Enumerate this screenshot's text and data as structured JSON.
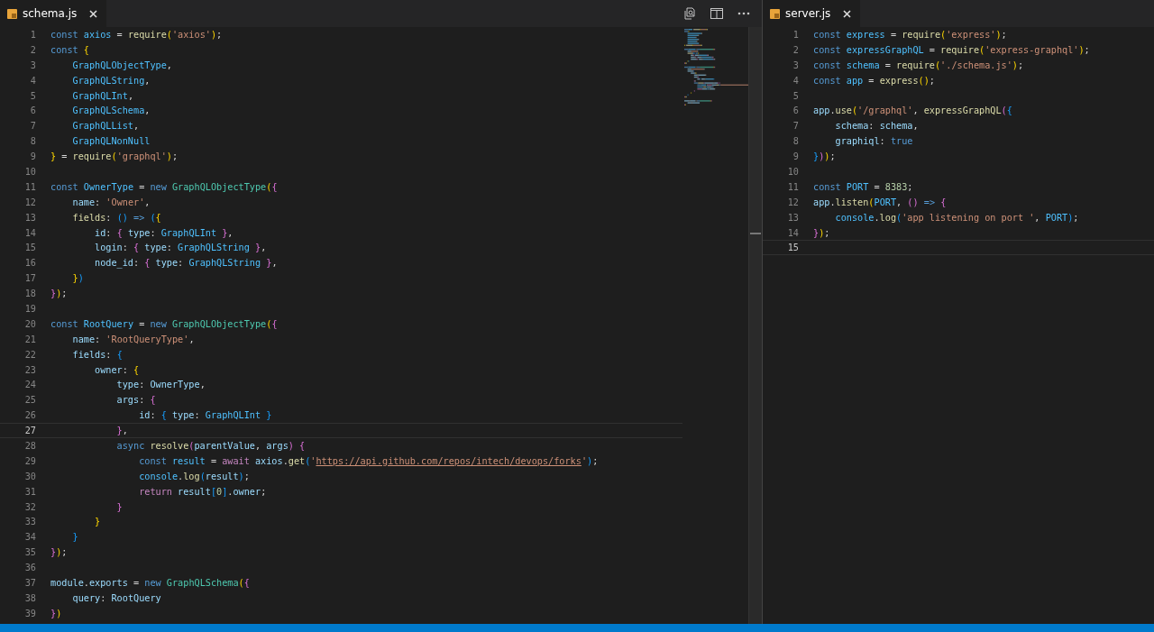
{
  "editor_groups": [
    {
      "tab": {
        "label": "schema.js",
        "selected": true
      },
      "actions": true,
      "minimap": true,
      "lines": [
        {
          "number": "1",
          "current": false,
          "tokens": [
            {
              "text": "const ",
              "kind": "keyword"
            },
            {
              "text": "axios",
              "kind": "constant"
            },
            {
              "text": " = ",
              "kind": "plain"
            },
            {
              "text": "require",
              "kind": "function"
            },
            {
              "text": "(",
              "kind": "bracket1"
            },
            {
              "text": "'axios'",
              "kind": "string"
            },
            {
              "text": ")",
              "kind": "bracket1"
            },
            {
              "text": ";",
              "kind": "plain"
            }
          ]
        },
        {
          "number": "2",
          "current": false,
          "tokens": [
            {
              "text": "const ",
              "kind": "keyword"
            },
            {
              "text": "{",
              "kind": "bracket1"
            }
          ]
        },
        {
          "number": "3",
          "current": false,
          "tokens": [
            {
              "text": "    GraphQLObjectType",
              "kind": "constant"
            },
            {
              "text": ",",
              "kind": "plain"
            }
          ]
        },
        {
          "number": "4",
          "current": false,
          "tokens": [
            {
              "text": "    GraphQLString",
              "kind": "constant"
            },
            {
              "text": ",",
              "kind": "plain"
            }
          ]
        },
        {
          "number": "5",
          "current": false,
          "tokens": [
            {
              "text": "    GraphQLInt",
              "kind": "constant"
            },
            {
              "text": ",",
              "kind": "plain"
            }
          ]
        },
        {
          "number": "6",
          "current": false,
          "tokens": [
            {
              "text": "    GraphQLSchema",
              "kind": "constant"
            },
            {
              "text": ",",
              "kind": "plain"
            }
          ]
        },
        {
          "number": "7",
          "current": false,
          "tokens": [
            {
              "text": "    GraphQLList",
              "kind": "constant"
            },
            {
              "text": ",",
              "kind": "plain"
            }
          ]
        },
        {
          "number": "8",
          "current": false,
          "tokens": [
            {
              "text": "    GraphQLNonNull",
              "kind": "constant"
            }
          ]
        },
        {
          "number": "9",
          "current": false,
          "tokens": [
            {
              "text": "}",
              "kind": "bracket1"
            },
            {
              "text": " = ",
              "kind": "plain"
            },
            {
              "text": "require",
              "kind": "function"
            },
            {
              "text": "(",
              "kind": "bracket1"
            },
            {
              "text": "'graphql'",
              "kind": "string"
            },
            {
              "text": ")",
              "kind": "bracket1"
            },
            {
              "text": ";",
              "kind": "plain"
            }
          ]
        },
        {
          "number": "10",
          "current": false
        },
        {
          "number": "11",
          "current": false,
          "tokens": [
            {
              "text": "const ",
              "kind": "keyword"
            },
            {
              "text": "OwnerType",
              "kind": "constant"
            },
            {
              "text": " = ",
              "kind": "plain"
            },
            {
              "text": "new ",
              "kind": "keyword"
            },
            {
              "text": "GraphQLObjectType",
              "kind": "type"
            },
            {
              "text": "(",
              "kind": "bracket1"
            },
            {
              "text": "{",
              "kind": "bracket2"
            }
          ]
        },
        {
          "number": "12",
          "current": false,
          "tokens": [
            {
              "text": "    name",
              "kind": "variable"
            },
            {
              "text": ": ",
              "kind": "plain"
            },
            {
              "text": "'Owner'",
              "kind": "string"
            },
            {
              "text": ",",
              "kind": "plain"
            }
          ]
        },
        {
          "number": "13",
          "current": false,
          "tokens": [
            {
              "text": "    fields",
              "kind": "function"
            },
            {
              "text": ": ",
              "kind": "plain"
            },
            {
              "text": "()",
              "kind": "bracket3"
            },
            {
              "text": " => ",
              "kind": "keyword"
            },
            {
              "text": "(",
              "kind": "bracket3"
            },
            {
              "text": "{",
              "kind": "bracket1"
            }
          ]
        },
        {
          "number": "14",
          "current": false,
          "tokens": [
            {
              "text": "        id",
              "kind": "variable"
            },
            {
              "text": ": ",
              "kind": "plain"
            },
            {
              "text": "{",
              "kind": "bracket2"
            },
            {
              "text": " type",
              "kind": "variable"
            },
            {
              "text": ": ",
              "kind": "plain"
            },
            {
              "text": "GraphQLInt ",
              "kind": "constant"
            },
            {
              "text": "}",
              "kind": "bracket2"
            },
            {
              "text": ",",
              "kind": "plain"
            }
          ]
        },
        {
          "number": "15",
          "current": false,
          "tokens": [
            {
              "text": "        login",
              "kind": "variable"
            },
            {
              "text": ": ",
              "kind": "plain"
            },
            {
              "text": "{",
              "kind": "bracket2"
            },
            {
              "text": " type",
              "kind": "variable"
            },
            {
              "text": ": ",
              "kind": "plain"
            },
            {
              "text": "GraphQLString ",
              "kind": "constant"
            },
            {
              "text": "}",
              "kind": "bracket2"
            },
            {
              "text": ",",
              "kind": "plain"
            }
          ]
        },
        {
          "number": "16",
          "current": false,
          "tokens": [
            {
              "text": "        node_id",
              "kind": "variable"
            },
            {
              "text": ": ",
              "kind": "plain"
            },
            {
              "text": "{",
              "kind": "bracket2"
            },
            {
              "text": " type",
              "kind": "variable"
            },
            {
              "text": ": ",
              "kind": "plain"
            },
            {
              "text": "GraphQLString ",
              "kind": "constant"
            },
            {
              "text": "}",
              "kind": "bracket2"
            },
            {
              "text": ",",
              "kind": "plain"
            }
          ]
        },
        {
          "number": "17",
          "current": false,
          "tokens": [
            {
              "text": "    }",
              "kind": "bracket1"
            },
            {
              "text": ")",
              "kind": "bracket3"
            }
          ]
        },
        {
          "number": "18",
          "current": false,
          "tokens": [
            {
              "text": "}",
              "kind": "bracket2"
            },
            {
              "text": ")",
              "kind": "bracket1"
            },
            {
              "text": ";",
              "kind": "plain"
            }
          ]
        },
        {
          "number": "19",
          "current": false
        },
        {
          "number": "20",
          "current": false,
          "tokens": [
            {
              "text": "const ",
              "kind": "keyword"
            },
            {
              "text": "RootQuery",
              "kind": "constant"
            },
            {
              "text": " = ",
              "kind": "plain"
            },
            {
              "text": "new ",
              "kind": "keyword"
            },
            {
              "text": "GraphQLObjectType",
              "kind": "type"
            },
            {
              "text": "(",
              "kind": "bracket1"
            },
            {
              "text": "{",
              "kind": "bracket2"
            }
          ]
        },
        {
          "number": "21",
          "current": false,
          "tokens": [
            {
              "text": "    name",
              "kind": "variable"
            },
            {
              "text": ": ",
              "kind": "plain"
            },
            {
              "text": "'RootQueryType'",
              "kind": "string"
            },
            {
              "text": ",",
              "kind": "plain"
            }
          ]
        },
        {
          "number": "22",
          "current": false,
          "tokens": [
            {
              "text": "    fields",
              "kind": "variable"
            },
            {
              "text": ": ",
              "kind": "plain"
            },
            {
              "text": "{",
              "kind": "bracket3"
            }
          ]
        },
        {
          "number": "23",
          "current": false,
          "tokens": [
            {
              "text": "        owner",
              "kind": "variable"
            },
            {
              "text": ": ",
              "kind": "plain"
            },
            {
              "text": "{",
              "kind": "bracket1"
            }
          ]
        },
        {
          "number": "24",
          "current": false,
          "tokens": [
            {
              "text": "            type",
              "kind": "variable"
            },
            {
              "text": ": ",
              "kind": "plain"
            },
            {
              "text": "OwnerType",
              "kind": "variable"
            },
            {
              "text": ",",
              "kind": "plain"
            }
          ]
        },
        {
          "number": "25",
          "current": false,
          "tokens": [
            {
              "text": "            args",
              "kind": "variable"
            },
            {
              "text": ": ",
              "kind": "plain"
            },
            {
              "text": "{",
              "kind": "bracket2"
            }
          ]
        },
        {
          "number": "26",
          "current": false,
          "tokens": [
            {
              "text": "                id",
              "kind": "variable"
            },
            {
              "text": ": ",
              "kind": "plain"
            },
            {
              "text": "{",
              "kind": "bracket3"
            },
            {
              "text": " type",
              "kind": "variable"
            },
            {
              "text": ": ",
              "kind": "plain"
            },
            {
              "text": "GraphQLInt ",
              "kind": "constant"
            },
            {
              "text": "}",
              "kind": "bracket3"
            }
          ]
        },
        {
          "number": "27",
          "current": true,
          "tokens": [
            {
              "text": "            }",
              "kind": "bracket2"
            },
            {
              "text": ",",
              "kind": "plain"
            }
          ]
        },
        {
          "number": "28",
          "current": false,
          "tokens": [
            {
              "text": "            async ",
              "kind": "keyword"
            },
            {
              "text": "resolve",
              "kind": "function"
            },
            {
              "text": "(",
              "kind": "bracket2"
            },
            {
              "text": "parentValue",
              "kind": "variable"
            },
            {
              "text": ", ",
              "kind": "plain"
            },
            {
              "text": "args",
              "kind": "variable"
            },
            {
              "text": ")",
              "kind": "bracket2"
            },
            {
              "text": " {",
              "kind": "bracket2"
            }
          ]
        },
        {
          "number": "29",
          "current": false,
          "tokens": [
            {
              "text": "                const ",
              "kind": "keyword"
            },
            {
              "text": "result",
              "kind": "constant"
            },
            {
              "text": " = ",
              "kind": "plain"
            },
            {
              "text": "await ",
              "kind": "control"
            },
            {
              "text": "axios",
              "kind": "variable"
            },
            {
              "text": ".",
              "kind": "plain"
            },
            {
              "text": "get",
              "kind": "function"
            },
            {
              "text": "(",
              "kind": "bracket3"
            },
            {
              "text": "'",
              "kind": "string"
            },
            {
              "text": "https://api.github.com/repos/intech/devops/forks",
              "kind": "link"
            },
            {
              "text": "'",
              "kind": "string"
            },
            {
              "text": ")",
              "kind": "bracket3"
            },
            {
              "text": ";",
              "kind": "plain"
            }
          ]
        },
        {
          "number": "30",
          "current": false,
          "tokens": [
            {
              "text": "                console",
              "kind": "constant"
            },
            {
              "text": ".",
              "kind": "plain"
            },
            {
              "text": "log",
              "kind": "function"
            },
            {
              "text": "(",
              "kind": "bracket3"
            },
            {
              "text": "result",
              "kind": "variable"
            },
            {
              "text": ")",
              "kind": "bracket3"
            },
            {
              "text": ";",
              "kind": "plain"
            }
          ]
        },
        {
          "number": "31",
          "current": false,
          "tokens": [
            {
              "text": "                return ",
              "kind": "control"
            },
            {
              "text": "result",
              "kind": "variable"
            },
            {
              "text": "[",
              "kind": "bracket3"
            },
            {
              "text": "0",
              "kind": "number"
            },
            {
              "text": "]",
              "kind": "bracket3"
            },
            {
              "text": ".",
              "kind": "plain"
            },
            {
              "text": "owner",
              "kind": "variable"
            },
            {
              "text": ";",
              "kind": "plain"
            }
          ]
        },
        {
          "number": "32",
          "current": false,
          "tokens": [
            {
              "text": "            }",
              "kind": "bracket2"
            }
          ]
        },
        {
          "number": "33",
          "current": false,
          "tokens": [
            {
              "text": "        }",
              "kind": "bracket1"
            }
          ]
        },
        {
          "number": "34",
          "current": false,
          "tokens": [
            {
              "text": "    }",
              "kind": "bracket3"
            }
          ]
        },
        {
          "number": "35",
          "current": false,
          "tokens": [
            {
              "text": "}",
              "kind": "bracket2"
            },
            {
              "text": ")",
              "kind": "bracket1"
            },
            {
              "text": ";",
              "kind": "plain"
            }
          ]
        },
        {
          "number": "36",
          "current": false
        },
        {
          "number": "37",
          "current": false,
          "tokens": [
            {
              "text": "module",
              "kind": "variable"
            },
            {
              "text": ".",
              "kind": "plain"
            },
            {
              "text": "exports",
              "kind": "variable"
            },
            {
              "text": " = ",
              "kind": "plain"
            },
            {
              "text": "new ",
              "kind": "keyword"
            },
            {
              "text": "GraphQLSchema",
              "kind": "type"
            },
            {
              "text": "(",
              "kind": "bracket1"
            },
            {
              "text": "{",
              "kind": "bracket2"
            }
          ]
        },
        {
          "number": "38",
          "current": false,
          "tokens": [
            {
              "text": "    query",
              "kind": "variable"
            },
            {
              "text": ": ",
              "kind": "plain"
            },
            {
              "text": "RootQuery",
              "kind": "variable"
            }
          ]
        },
        {
          "number": "39",
          "current": false,
          "tokens": [
            {
              "text": "}",
              "kind": "bracket2"
            },
            {
              "text": ")",
              "kind": "bracket1"
            }
          ]
        }
      ]
    },
    {
      "tab": {
        "label": "server.js",
        "selected": true
      },
      "actions": false,
      "minimap": false,
      "lines": [
        {
          "number": "1",
          "current": false,
          "tokens": [
            {
              "text": "const ",
              "kind": "keyword"
            },
            {
              "text": "express",
              "kind": "constant"
            },
            {
              "text": " = ",
              "kind": "plain"
            },
            {
              "text": "require",
              "kind": "function"
            },
            {
              "text": "(",
              "kind": "bracket1"
            },
            {
              "text": "'express'",
              "kind": "string"
            },
            {
              "text": ")",
              "kind": "bracket1"
            },
            {
              "text": ";",
              "kind": "plain"
            }
          ]
        },
        {
          "number": "2",
          "current": false,
          "tokens": [
            {
              "text": "const ",
              "kind": "keyword"
            },
            {
              "text": "expressGraphQL",
              "kind": "constant"
            },
            {
              "text": " = ",
              "kind": "plain"
            },
            {
              "text": "require",
              "kind": "function"
            },
            {
              "text": "(",
              "kind": "bracket1"
            },
            {
              "text": "'express-graphql'",
              "kind": "string"
            },
            {
              "text": ")",
              "kind": "bracket1"
            },
            {
              "text": ";",
              "kind": "plain"
            }
          ]
        },
        {
          "number": "3",
          "current": false,
          "tokens": [
            {
              "text": "const ",
              "kind": "keyword"
            },
            {
              "text": "schema",
              "kind": "constant"
            },
            {
              "text": " = ",
              "kind": "plain"
            },
            {
              "text": "require",
              "kind": "function"
            },
            {
              "text": "(",
              "kind": "bracket1"
            },
            {
              "text": "'./schema.js'",
              "kind": "string"
            },
            {
              "text": ")",
              "kind": "bracket1"
            },
            {
              "text": ";",
              "kind": "plain"
            }
          ]
        },
        {
          "number": "4",
          "current": false,
          "tokens": [
            {
              "text": "const ",
              "kind": "keyword"
            },
            {
              "text": "app",
              "kind": "constant"
            },
            {
              "text": " = ",
              "kind": "plain"
            },
            {
              "text": "express",
              "kind": "function"
            },
            {
              "text": "()",
              "kind": "bracket1"
            },
            {
              "text": ";",
              "kind": "plain"
            }
          ]
        },
        {
          "number": "5",
          "current": false
        },
        {
          "number": "6",
          "current": false,
          "tokens": [
            {
              "text": "app",
              "kind": "variable"
            },
            {
              "text": ".",
              "kind": "plain"
            },
            {
              "text": "use",
              "kind": "function"
            },
            {
              "text": "(",
              "kind": "bracket1"
            },
            {
              "text": "'/graphql'",
              "kind": "string"
            },
            {
              "text": ", ",
              "kind": "plain"
            },
            {
              "text": "expressGraphQL",
              "kind": "function"
            },
            {
              "text": "(",
              "kind": "bracket2"
            },
            {
              "text": "{",
              "kind": "bracket3"
            }
          ]
        },
        {
          "number": "7",
          "current": false,
          "tokens": [
            {
              "text": "    schema",
              "kind": "variable"
            },
            {
              "text": ": ",
              "kind": "plain"
            },
            {
              "text": "schema",
              "kind": "variable"
            },
            {
              "text": ",",
              "kind": "plain"
            }
          ]
        },
        {
          "number": "8",
          "current": false,
          "tokens": [
            {
              "text": "    graphiql",
              "kind": "variable"
            },
            {
              "text": ": ",
              "kind": "plain"
            },
            {
              "text": "true",
              "kind": "keyword"
            }
          ]
        },
        {
          "number": "9",
          "current": false,
          "tokens": [
            {
              "text": "}",
              "kind": "bracket3"
            },
            {
              "text": ")",
              "kind": "bracket2"
            },
            {
              "text": ")",
              "kind": "bracket1"
            },
            {
              "text": ";",
              "kind": "plain"
            }
          ]
        },
        {
          "number": "10",
          "current": false
        },
        {
          "number": "11",
          "current": false,
          "tokens": [
            {
              "text": "const ",
              "kind": "keyword"
            },
            {
              "text": "PORT",
              "kind": "constant"
            },
            {
              "text": " = ",
              "kind": "plain"
            },
            {
              "text": "8383",
              "kind": "number"
            },
            {
              "text": ";",
              "kind": "plain"
            }
          ]
        },
        {
          "number": "12",
          "current": false,
          "tokens": [
            {
              "text": "app",
              "kind": "variable"
            },
            {
              "text": ".",
              "kind": "plain"
            },
            {
              "text": "listen",
              "kind": "function"
            },
            {
              "text": "(",
              "kind": "bracket1"
            },
            {
              "text": "PORT",
              "kind": "constant"
            },
            {
              "text": ", ",
              "kind": "plain"
            },
            {
              "text": "()",
              "kind": "bracket2"
            },
            {
              "text": " => ",
              "kind": "keyword"
            },
            {
              "text": "{",
              "kind": "bracket2"
            }
          ]
        },
        {
          "number": "13",
          "current": false,
          "tokens": [
            {
              "text": "    console",
              "kind": "constant"
            },
            {
              "text": ".",
              "kind": "plain"
            },
            {
              "text": "log",
              "kind": "function"
            },
            {
              "text": "(",
              "kind": "bracket3"
            },
            {
              "text": "'app listening on port '",
              "kind": "string"
            },
            {
              "text": ", ",
              "kind": "plain"
            },
            {
              "text": "PORT",
              "kind": "constant"
            },
            {
              "text": ")",
              "kind": "bracket3"
            },
            {
              "text": ";",
              "kind": "plain"
            }
          ]
        },
        {
          "number": "14",
          "current": false,
          "tokens": [
            {
              "text": "}",
              "kind": "bracket2"
            },
            {
              "text": ")",
              "kind": "bracket1"
            },
            {
              "text": ";",
              "kind": "plain"
            }
          ]
        },
        {
          "number": "15",
          "current": true
        }
      ]
    }
  ]
}
